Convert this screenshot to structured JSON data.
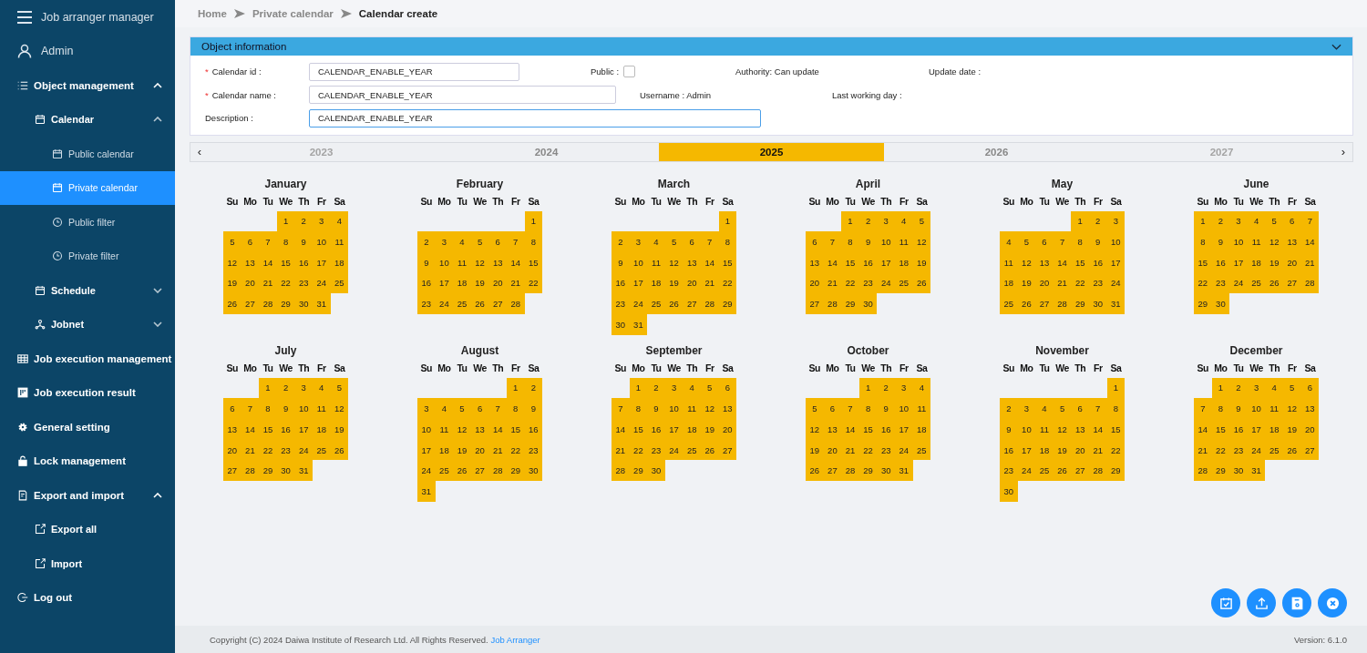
{
  "sidebar": {
    "title": "Job arranger manager",
    "user": "Admin",
    "items": [
      {
        "label": "Object management",
        "selected": false,
        "expanded": true,
        "children": [
          {
            "label": "Calendar",
            "selected": false,
            "expanded": true,
            "children": [
              {
                "label": "Public calendar",
                "selected": false
              },
              {
                "label": "Private calendar",
                "selected": true
              },
              {
                "label": "Public filter",
                "selected": false
              },
              {
                "label": "Private filter",
                "selected": false
              }
            ]
          },
          {
            "label": "Schedule",
            "selected": false,
            "expanded": false
          },
          {
            "label": "Jobnet",
            "selected": false,
            "expanded": false
          }
        ]
      },
      {
        "label": "Job execution management",
        "selected": false
      },
      {
        "label": "Job execution result",
        "selected": false
      },
      {
        "label": "General setting",
        "selected": false
      },
      {
        "label": "Lock management",
        "selected": false
      },
      {
        "label": "Export and import",
        "selected": false,
        "expanded": true,
        "children": [
          {
            "label": "Export all",
            "selected": false
          },
          {
            "label": "Import",
            "selected": false
          }
        ]
      },
      {
        "label": "Log out",
        "selected": false
      }
    ]
  },
  "breadcrumb": [
    {
      "label": "Home",
      "current": false
    },
    {
      "label": "Private calendar",
      "current": false
    },
    {
      "label": "Calendar create",
      "current": true
    }
  ],
  "panel": {
    "title": "Object information",
    "expanded": true,
    "fields": [
      {
        "label": "Calendar id :",
        "mark": "*",
        "value": "CALENDAR_ENABLE_YEAR",
        "focused": false
      },
      {
        "label": "Calendar name :",
        "mark": "*",
        "value": "CALENDAR_ENABLE_YEAR",
        "focused": false
      },
      {
        "label": "Description :",
        "value": "CALENDAR_ENABLE_YEAR",
        "focused": true
      }
    ],
    "public": {
      "label": "Public :",
      "checked": false
    },
    "authority": "Authority: Can update",
    "update_date": "Update date :",
    "username": "Username : Admin",
    "last_working_day": "Last working day :"
  },
  "years": {
    "prev": "‹",
    "next": "›",
    "items": [
      {
        "label": "2023",
        "selected": false,
        "faded": true
      },
      {
        "label": "2024",
        "selected": false,
        "faded": false
      },
      {
        "label": "2025",
        "selected": true,
        "faded": false
      },
      {
        "label": "2026",
        "selected": false,
        "faded": false
      },
      {
        "label": "2027",
        "selected": false,
        "faded": true
      }
    ]
  },
  "months": [
    {
      "name": "January",
      "selected": true,
      "weekdays": [
        "Su",
        "Mo",
        "Tu",
        "We",
        "Th",
        "Fr",
        "Sa"
      ],
      "weeks": [
        [
          "1",
          "2",
          "3",
          "4"
        ],
        [
          "5",
          "6",
          "7",
          "8",
          "9",
          "10",
          "11"
        ],
        [
          "12",
          "13",
          "14",
          "15",
          "16",
          "17",
          "18"
        ],
        [
          "19",
          "20",
          "21",
          "22",
          "23",
          "24",
          "25"
        ],
        [
          "26",
          "27",
          "28",
          "29",
          "30",
          "31"
        ]
      ]
    },
    {
      "name": "February",
      "selected": true,
      "weekdays": [
        "Su",
        "Mo",
        "Tu",
        "We",
        "Th",
        "Fr",
        "Sa"
      ],
      "weeks": [
        [
          "1"
        ],
        [
          "2",
          "3",
          "4",
          "5",
          "6",
          "7",
          "8"
        ],
        [
          "9",
          "10",
          "11",
          "12",
          "13",
          "14",
          "15"
        ],
        [
          "16",
          "17",
          "18",
          "19",
          "20",
          "21",
          "22"
        ],
        [
          "23",
          "24",
          "25",
          "26",
          "27",
          "28"
        ]
      ]
    },
    {
      "name": "March",
      "selected": true,
      "weekdays": [
        "Su",
        "Mo",
        "Tu",
        "We",
        "Th",
        "Fr",
        "Sa"
      ],
      "weeks": [
        [
          "1"
        ],
        [
          "2",
          "3",
          "4",
          "5",
          "6",
          "7",
          "8"
        ],
        [
          "9",
          "10",
          "11",
          "12",
          "13",
          "14",
          "15"
        ],
        [
          "16",
          "17",
          "18",
          "19",
          "20",
          "21",
          "22"
        ],
        [
          "23",
          "24",
          "25",
          "26",
          "27",
          "28",
          "29"
        ],
        [
          "30",
          "31"
        ]
      ]
    },
    {
      "name": "April",
      "selected": true,
      "weekdays": [
        "Su",
        "Mo",
        "Tu",
        "We",
        "Th",
        "Fr",
        "Sa"
      ],
      "weeks": [
        [
          "1",
          "2",
          "3",
          "4",
          "5"
        ],
        [
          "6",
          "7",
          "8",
          "9",
          "10",
          "11",
          "12"
        ],
        [
          "13",
          "14",
          "15",
          "16",
          "17",
          "18",
          "19"
        ],
        [
          "20",
          "21",
          "22",
          "23",
          "24",
          "25",
          "26"
        ],
        [
          "27",
          "28",
          "29",
          "30"
        ]
      ]
    },
    {
      "name": "May",
      "selected": true,
      "weekdays": [
        "Su",
        "Mo",
        "Tu",
        "We",
        "Th",
        "Fr",
        "Sa"
      ],
      "weeks": [
        [
          "1",
          "2",
          "3"
        ],
        [
          "4",
          "5",
          "6",
          "7",
          "8",
          "9",
          "10"
        ],
        [
          "11",
          "12",
          "13",
          "14",
          "15",
          "16",
          "17"
        ],
        [
          "18",
          "19",
          "20",
          "21",
          "22",
          "23",
          "24"
        ],
        [
          "25",
          "26",
          "27",
          "28",
          "29",
          "30",
          "31"
        ]
      ]
    },
    {
      "name": "June",
      "selected": true,
      "weekdays": [
        "Su",
        "Mo",
        "Tu",
        "We",
        "Th",
        "Fr",
        "Sa"
      ],
      "weeks": [
        [
          "1",
          "2",
          "3",
          "4",
          "5",
          "6",
          "7"
        ],
        [
          "8",
          "9",
          "10",
          "11",
          "12",
          "13",
          "14"
        ],
        [
          "15",
          "16",
          "17",
          "18",
          "19",
          "20",
          "21"
        ],
        [
          "22",
          "23",
          "24",
          "25",
          "26",
          "27",
          "28"
        ],
        [
          "29",
          "30"
        ]
      ]
    },
    {
      "name": "July",
      "selected": true,
      "weekdays": [
        "Su",
        "Mo",
        "Tu",
        "We",
        "Th",
        "Fr",
        "Sa"
      ],
      "weeks": [
        [
          "1",
          "2",
          "3",
          "4",
          "5"
        ],
        [
          "6",
          "7",
          "8",
          "9",
          "10",
          "11",
          "12"
        ],
        [
          "13",
          "14",
          "15",
          "16",
          "17",
          "18",
          "19"
        ],
        [
          "20",
          "21",
          "22",
          "23",
          "24",
          "25",
          "26"
        ],
        [
          "27",
          "28",
          "29",
          "30",
          "31"
        ]
      ]
    },
    {
      "name": "August",
      "selected": true,
      "weekdays": [
        "Su",
        "Mo",
        "Tu",
        "We",
        "Th",
        "Fr",
        "Sa"
      ],
      "weeks": [
        [
          "1",
          "2"
        ],
        [
          "3",
          "4",
          "5",
          "6",
          "7",
          "8",
          "9"
        ],
        [
          "10",
          "11",
          "12",
          "13",
          "14",
          "15",
          "16"
        ],
        [
          "17",
          "18",
          "19",
          "20",
          "21",
          "22",
          "23"
        ],
        [
          "24",
          "25",
          "26",
          "27",
          "28",
          "29",
          "30"
        ],
        [
          "31"
        ]
      ]
    },
    {
      "name": "September",
      "selected": true,
      "weekdays": [
        "Su",
        "Mo",
        "Tu",
        "We",
        "Th",
        "Fr",
        "Sa"
      ],
      "weeks": [
        [
          "1",
          "2",
          "3",
          "4",
          "5",
          "6"
        ],
        [
          "7",
          "8",
          "9",
          "10",
          "11",
          "12",
          "13"
        ],
        [
          "14",
          "15",
          "16",
          "17",
          "18",
          "19",
          "20"
        ],
        [
          "21",
          "22",
          "23",
          "24",
          "25",
          "26",
          "27"
        ],
        [
          "28",
          "29",
          "30"
        ]
      ]
    },
    {
      "name": "October",
      "selected": true,
      "weekdays": [
        "Su",
        "Mo",
        "Tu",
        "We",
        "Th",
        "Fr",
        "Sa"
      ],
      "weeks": [
        [
          "1",
          "2",
          "3",
          "4"
        ],
        [
          "5",
          "6",
          "7",
          "8",
          "9",
          "10",
          "11"
        ],
        [
          "12",
          "13",
          "14",
          "15",
          "16",
          "17",
          "18"
        ],
        [
          "19",
          "20",
          "21",
          "22",
          "23",
          "24",
          "25"
        ],
        [
          "26",
          "27",
          "28",
          "29",
          "30",
          "31"
        ]
      ]
    },
    {
      "name": "November",
      "selected": true,
      "weekdays": [
        "Su",
        "Mo",
        "Tu",
        "We",
        "Th",
        "Fr",
        "Sa"
      ],
      "weeks": [
        [
          "1"
        ],
        [
          "2",
          "3",
          "4",
          "5",
          "6",
          "7",
          "8"
        ],
        [
          "9",
          "10",
          "11",
          "12",
          "13",
          "14",
          "15"
        ],
        [
          "16",
          "17",
          "18",
          "19",
          "20",
          "21",
          "22"
        ],
        [
          "23",
          "24",
          "25",
          "26",
          "27",
          "28",
          "29"
        ],
        [
          "30"
        ]
      ]
    },
    {
      "name": "December",
      "selected": true,
      "weekdays": [
        "Su",
        "Mo",
        "Tu",
        "We",
        "Th",
        "Fr",
        "Sa"
      ],
      "weeks": [
        [
          "1",
          "2",
          "3",
          "4",
          "5",
          "6"
        ],
        [
          "7",
          "8",
          "9",
          "10",
          "11",
          "12",
          "13"
        ],
        [
          "14",
          "15",
          "16",
          "17",
          "18",
          "19",
          "20"
        ],
        [
          "21",
          "22",
          "23",
          "24",
          "25",
          "26",
          "27"
        ],
        [
          "28",
          "29",
          "30",
          "31"
        ]
      ]
    }
  ],
  "footer": {
    "copyright": "Copyright (C) 2024 Daiwa Institute of Research Ltd. All Rights Reserved.",
    "link": "Job Arranger",
    "version": "Version: 6.1.0"
  }
}
